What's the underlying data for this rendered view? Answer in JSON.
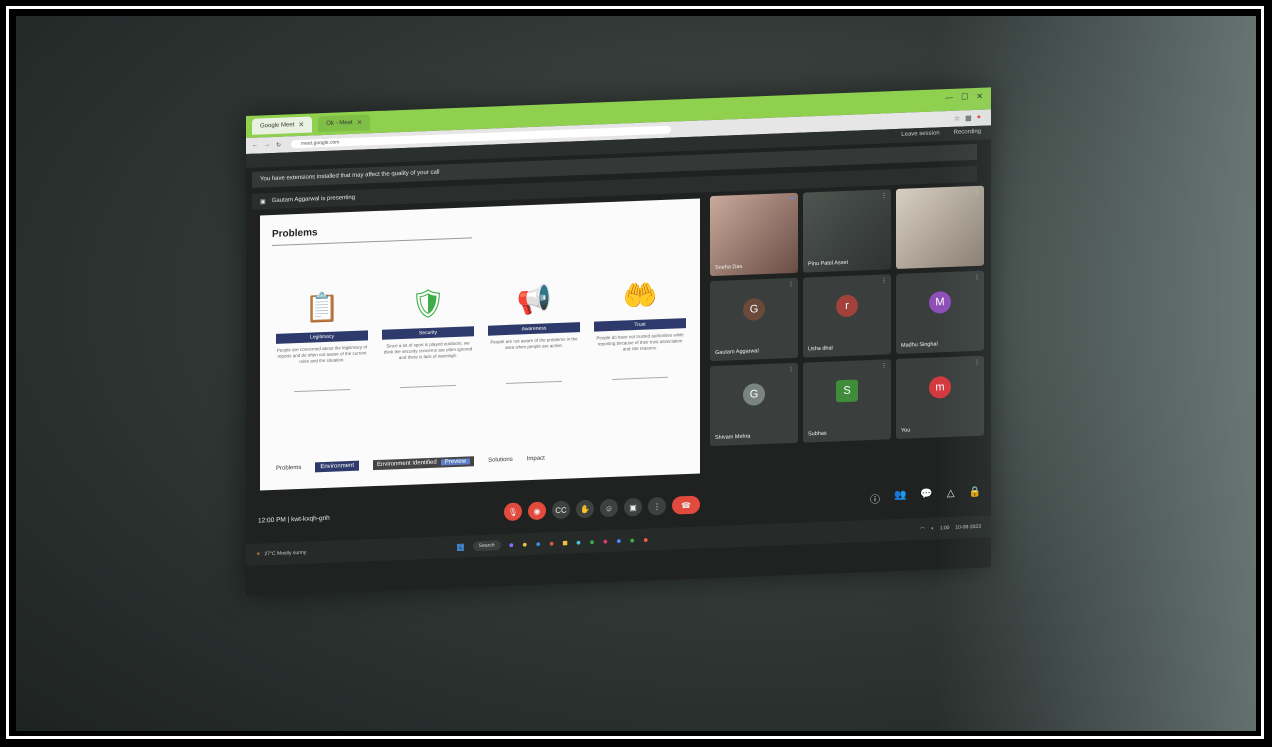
{
  "browser": {
    "tabs": [
      {
        "label": "Google Meet",
        "active": true
      },
      {
        "label": "Ok - Meet",
        "active": false
      }
    ],
    "url": "meet.google.com"
  },
  "meet_topbar": {
    "items": [
      "Leave session",
      "Recording"
    ]
  },
  "notice": "You have extensions installed that may affect the quality of your call",
  "presenting": "Gautam Aggarwal is presenting",
  "slide": {
    "title": "Problems",
    "cards": [
      {
        "icon": "checklist-icon",
        "heading": "Legitimacy",
        "text": "People are concerned about the legitimacy of reports and do often not aware of the current rules and the situation."
      },
      {
        "icon": "shield-icon",
        "heading": "Security",
        "text": "Since a lot of sport is played outdoors, we think the security concerns are often ignored and there is lack of warnings."
      },
      {
        "icon": "megaphone-icon",
        "heading": "Awareness",
        "text": "People are not aware of the problems in the area when people are active."
      },
      {
        "icon": "hands-icon",
        "heading": "Trust",
        "text": "People do have not trusted authorities while reporting because of their trust association and site reasons."
      }
    ],
    "nav": {
      "items": [
        "Problems",
        "Environment",
        "Solutions",
        "Impact"
      ],
      "selected": "Environment",
      "input": "Environment Identified",
      "input_tag": "Preview"
    }
  },
  "participants": [
    {
      "name": "Sneha Das",
      "kind": "video-a"
    },
    {
      "name": "Pinu Patel Asset",
      "kind": "video-b"
    },
    {
      "name": "",
      "kind": "video-c"
    },
    {
      "name": "Gautam Aggarwal",
      "kind": "photo-avatar",
      "avatar": "G",
      "color": "#6b4a3a"
    },
    {
      "name": "Usha dhal",
      "kind": "avatar",
      "avatar": "r",
      "color": "#a0413a"
    },
    {
      "name": "Madhu Singhal",
      "kind": "avatar",
      "avatar": "M",
      "color": "#8d4fb8"
    },
    {
      "name": "Shivam Mehra",
      "kind": "avatar",
      "avatar": "G",
      "color": "#7b8580"
    },
    {
      "name": "Subhas",
      "kind": "avatar",
      "avatar": "S",
      "color": "#3f8c3a"
    },
    {
      "name": "You",
      "kind": "avatar",
      "avatar": "m",
      "color": "#d4393f"
    }
  ],
  "controls": {
    "time": "12:00 PM",
    "meeting_code": "kwt-kxqh-gnh"
  },
  "taskbar": {
    "weather": "27°C Mostly sunny",
    "search": "Search",
    "tray_time": "1:00",
    "tray_date": "10-08-2023"
  }
}
